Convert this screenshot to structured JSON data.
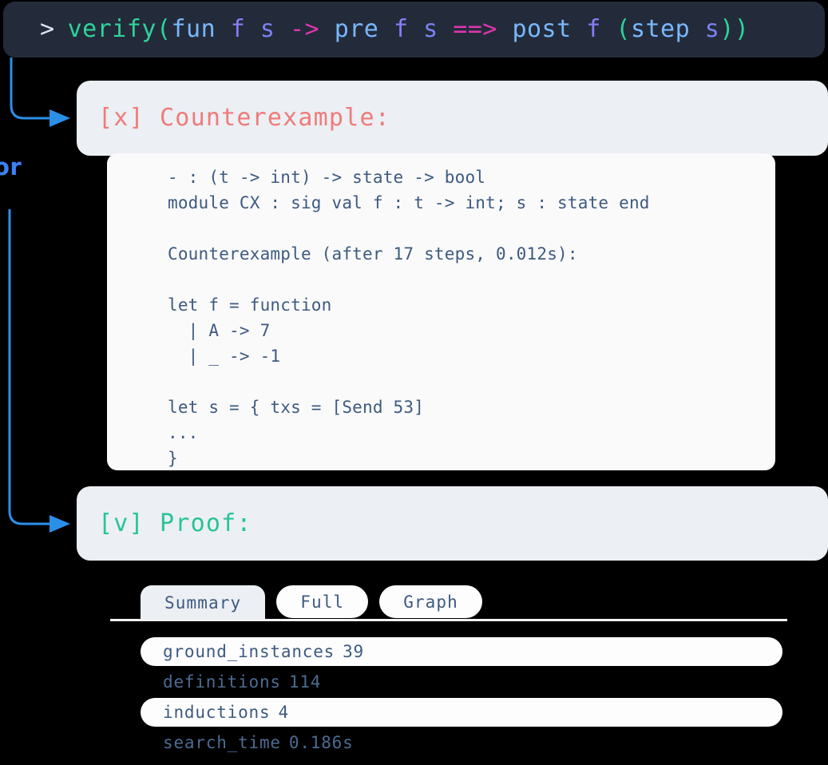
{
  "command_bar": {
    "prompt": ">",
    "tokens": [
      {
        "text": "verify",
        "kind": "fn"
      },
      {
        "text": "(",
        "kind": "paren"
      },
      {
        "text": "fun",
        "kind": "kw"
      },
      {
        "text": " ",
        "kind": "plain"
      },
      {
        "text": "f",
        "kind": "var"
      },
      {
        "text": " ",
        "kind": "plain"
      },
      {
        "text": "s",
        "kind": "var2"
      },
      {
        "text": " ",
        "kind": "plain"
      },
      {
        "text": "->",
        "kind": "arrow"
      },
      {
        "text": " ",
        "kind": "plain"
      },
      {
        "text": "pre",
        "kind": "ident"
      },
      {
        "text": " ",
        "kind": "plain"
      },
      {
        "text": "f",
        "kind": "var"
      },
      {
        "text": " ",
        "kind": "plain"
      },
      {
        "text": "s",
        "kind": "var2"
      },
      {
        "text": " ",
        "kind": "plain"
      },
      {
        "text": "==>",
        "kind": "arrow"
      },
      {
        "text": " ",
        "kind": "plain"
      },
      {
        "text": "post",
        "kind": "ident"
      },
      {
        "text": " ",
        "kind": "plain"
      },
      {
        "text": "f",
        "kind": "var"
      },
      {
        "text": " ",
        "kind": "plain"
      },
      {
        "text": "(",
        "kind": "paren"
      },
      {
        "text": "step",
        "kind": "ident"
      },
      {
        "text": " ",
        "kind": "plain"
      },
      {
        "text": "s",
        "kind": "var2"
      },
      {
        "text": ")",
        "kind": "paren"
      },
      {
        "text": ")",
        "kind": "paren"
      }
    ],
    "full_text": "> verify(fun f s -> pre f s ==> post f (step s))"
  },
  "branch_label": "or",
  "counterexample": {
    "label": "[x] Counterexample:",
    "accent": "#ef7b7b",
    "code_lines": [
      "- : (t -> int) -> state -> bool",
      "module CX : sig val f : t -> int; s : state end",
      "",
      "Counterexample (after 17 steps, 0.012s):",
      "",
      "let f = function",
      "  | A -> 7",
      "  | _ -> -1",
      "",
      "let s = { txs = [Send 53]",
      "...",
      "}"
    ]
  },
  "proof": {
    "label": "[v] Proof:",
    "accent": "#27c498"
  },
  "tabs": [
    {
      "label": "Summary",
      "active": true
    },
    {
      "label": "Full",
      "active": false
    },
    {
      "label": "Graph",
      "active": false
    }
  ],
  "metrics": [
    {
      "key": "ground_instances",
      "value": "39",
      "style": "filled"
    },
    {
      "key": "definitions",
      "value": "114",
      "style": "plain"
    },
    {
      "key": "inductions",
      "value": "4",
      "style": "filled"
    },
    {
      "key": "search_time",
      "value": "0.186s",
      "style": "plain"
    }
  ],
  "colors": {
    "background": "#000000",
    "command_bar_bg": "#232b3b",
    "card_bg": "#eceff3",
    "panel_bg": "#fafafa",
    "connector": "#2b8fe8",
    "branch_label": "#3b82f6",
    "code_text": "#3d5a80"
  }
}
